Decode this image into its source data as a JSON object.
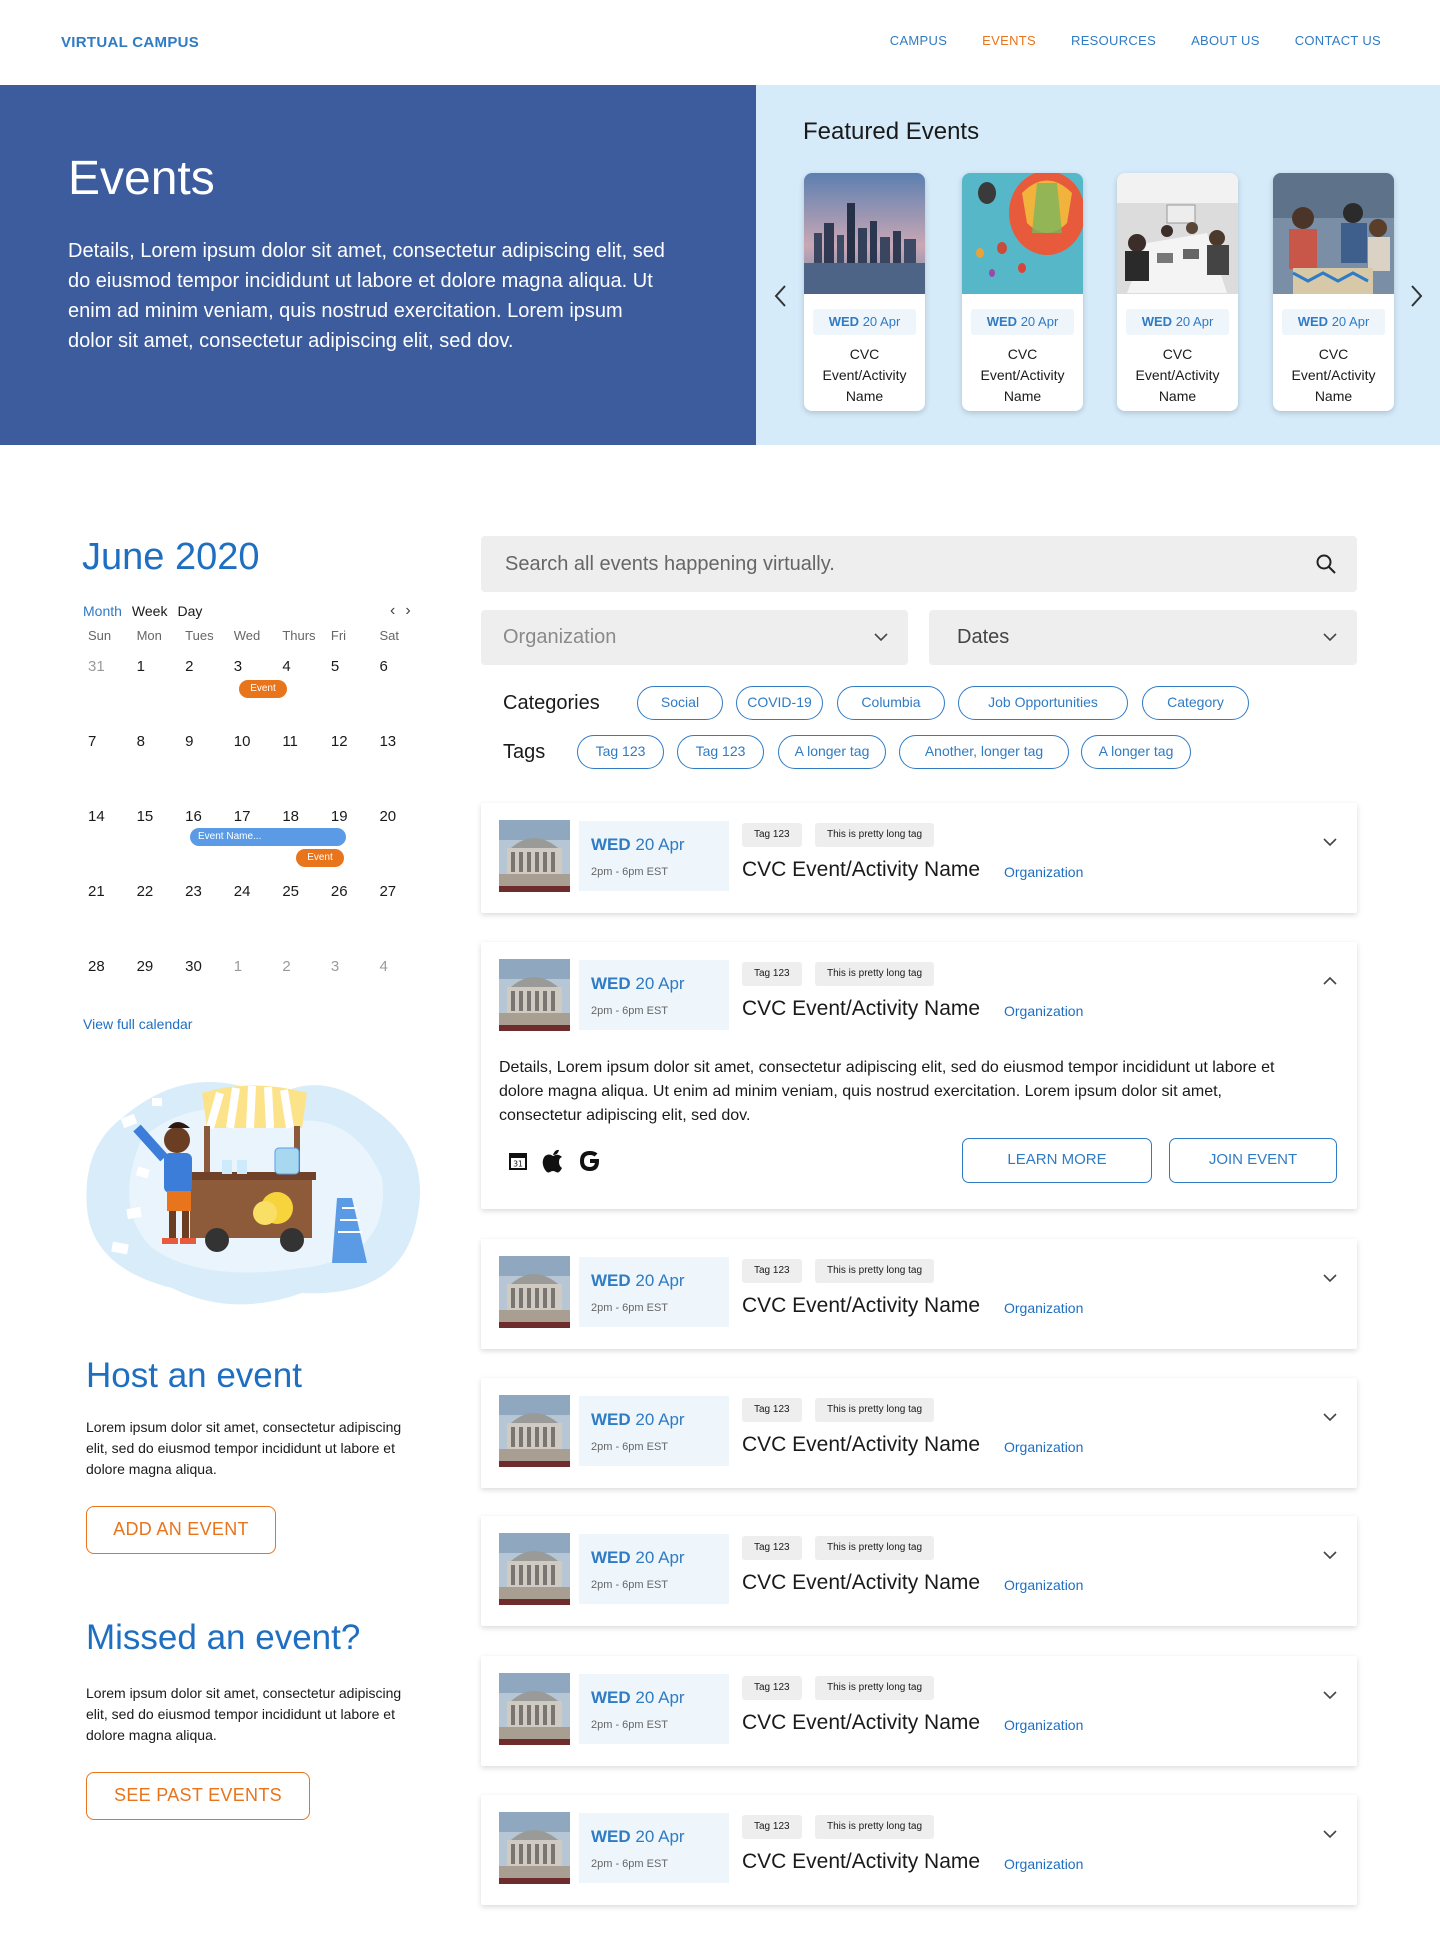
{
  "nav": {
    "brand": "VIRTUAL CAMPUS",
    "links": [
      "CAMPUS",
      "EVENTS",
      "RESOURCES",
      "ABOUT US",
      "CONTACT US"
    ],
    "active_index": 1
  },
  "hero": {
    "title": "Events",
    "description": "Details, Lorem ipsum dolor sit amet, consectetur adipiscing elit, sed do eiusmod tempor incididunt ut labore et dolore magna aliqua. Ut enim ad minim veniam, quis nostrud exercitation. Lorem ipsum dolor sit amet, consectetur adipiscing elit, sed dov."
  },
  "featured": {
    "title": "Featured Events",
    "cards": [
      {
        "day": "WED",
        "date": "20 Apr",
        "name": "CVC Event/Activity Name",
        "image": "city-skyline"
      },
      {
        "day": "WED",
        "date": "20 Apr",
        "name": "CVC Event/Activity Name",
        "image": "hot-air-balloons"
      },
      {
        "day": "WED",
        "date": "20 Apr",
        "name": "CVC Event/Activity Name",
        "image": "meeting-room"
      },
      {
        "day": "WED",
        "date": "20 Apr",
        "name": "CVC Event/Activity Name",
        "image": "group-workshop"
      }
    ]
  },
  "calendar": {
    "title": "June 2020",
    "modes": [
      "Month",
      "Week",
      "Day"
    ],
    "active_mode": "Month",
    "weekdays": [
      "Sun",
      "Mon",
      "Tues",
      "Wed",
      "Thurs",
      "Fri",
      "Sat"
    ],
    "weeks": [
      [
        "31",
        "1",
        "2",
        "3",
        "4",
        "5",
        "6"
      ],
      [
        "7",
        "8",
        "9",
        "10",
        "11",
        "12",
        "13"
      ],
      [
        "14",
        "15",
        "16",
        "17",
        "18",
        "19",
        "20"
      ],
      [
        "21",
        "22",
        "23",
        "24",
        "25",
        "26",
        "27"
      ],
      [
        "28",
        "29",
        "30",
        "1",
        "2",
        "3",
        "4"
      ]
    ],
    "event_label": "Event",
    "event_name_label": "Event Name...",
    "view_full": "View full calendar"
  },
  "host": {
    "title": "Host an event",
    "text": "Lorem ipsum dolor sit amet, consectetur adipiscing elit, sed do eiusmod tempor incididunt ut labore et dolore magna aliqua.",
    "button": "ADD AN EVENT"
  },
  "missed": {
    "title": "Missed an event?",
    "text": "Lorem ipsum dolor sit amet, consectetur adipiscing elit, sed do eiusmod tempor incididunt ut labore et dolore magna aliqua.",
    "button": "SEE PAST EVENTS"
  },
  "search": {
    "placeholder": "Search all events happening virtually."
  },
  "filters": {
    "organization": "Organization",
    "dates": "Dates"
  },
  "categories": {
    "label": "Categories",
    "items": [
      "Social",
      "COVID-19",
      "Columbia",
      "Job Opportunities",
      "Category"
    ]
  },
  "tags": {
    "label": "Tags",
    "items": [
      "Tag 123",
      "Tag 123",
      "A longer tag",
      "Another, longer tag",
      "A longer tag"
    ]
  },
  "events": [
    {
      "day": "WED",
      "date": "20 Apr",
      "time": "2pm - 6pm EST",
      "tags": [
        "Tag 123",
        "This is pretty long tag"
      ],
      "name": "CVC Event/Activity Name",
      "org": "Organization",
      "expanded": false
    },
    {
      "day": "WED",
      "date": "20 Apr",
      "time": "2pm - 6pm EST",
      "tags": [
        "Tag 123",
        "This is pretty long tag"
      ],
      "name": "CVC Event/Activity Name",
      "org": "Organization",
      "expanded": true,
      "description": "Details, Lorem ipsum dolor sit amet, consectetur adipiscing elit, sed do eiusmod tempor incididunt ut labore et dolore magna aliqua. Ut enim ad minim veniam, quis nostrud exercitation. Lorem ipsum dolor sit amet, consectetur adipiscing elit, sed dov.",
      "learn_more": "LEARN MORE",
      "join": "JOIN EVENT",
      "calendar_icons": [
        "google-calendar-icon",
        "apple-icon",
        "google-icon"
      ],
      "calendar_day": "31"
    },
    {
      "day": "WED",
      "date": "20 Apr",
      "time": "2pm - 6pm EST",
      "tags": [
        "Tag 123",
        "This is pretty long tag"
      ],
      "name": "CVC Event/Activity Name",
      "org": "Organization",
      "expanded": false
    },
    {
      "day": "WED",
      "date": "20 Apr",
      "time": "2pm - 6pm EST",
      "tags": [
        "Tag 123",
        "This is pretty long tag"
      ],
      "name": "CVC Event/Activity Name",
      "org": "Organization",
      "expanded": false
    },
    {
      "day": "WED",
      "date": "20 Apr",
      "time": "2pm - 6pm EST",
      "tags": [
        "Tag 123",
        "This is pretty long tag"
      ],
      "name": "CVC Event/Activity Name",
      "org": "Organization",
      "expanded": false
    },
    {
      "day": "WED",
      "date": "20 Apr",
      "time": "2pm - 6pm EST",
      "tags": [
        "Tag 123",
        "This is pretty long tag"
      ],
      "name": "CVC Event/Activity Name",
      "org": "Organization",
      "expanded": false
    },
    {
      "day": "WED",
      "date": "20 Apr",
      "time": "2pm - 6pm EST",
      "tags": [
        "Tag 123",
        "This is pretty long tag"
      ],
      "name": "CVC Event/Activity Name",
      "org": "Organization",
      "expanded": false
    }
  ],
  "colors": {
    "primary": "#2F7BC4",
    "accent": "#E8741C",
    "hero": "#3C5C9E",
    "featured_bg": "#D5EBFA"
  }
}
